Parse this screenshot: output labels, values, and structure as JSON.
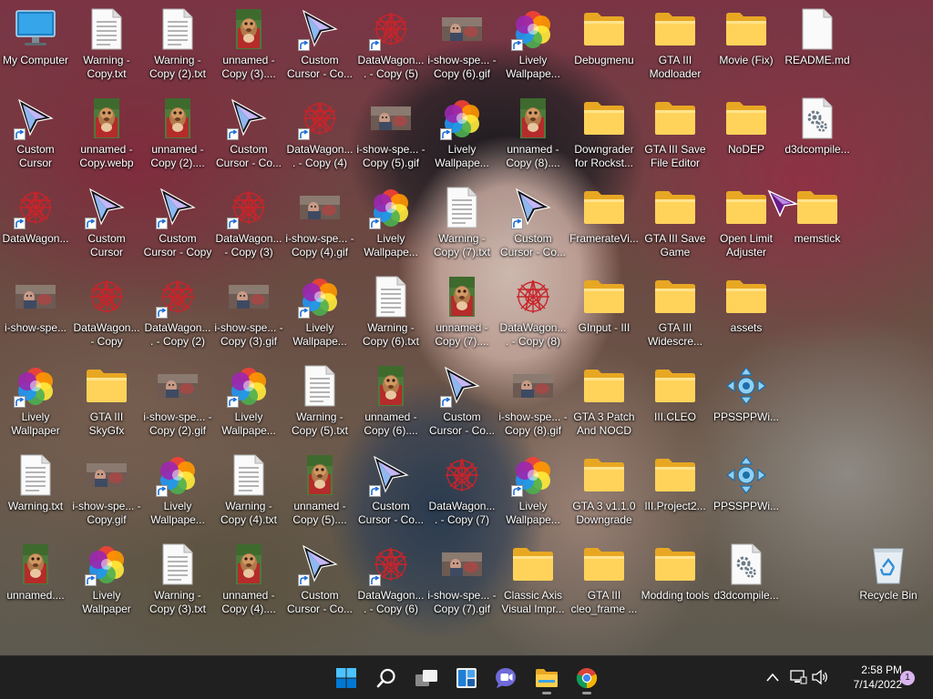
{
  "desktop": {
    "icons": [
      {
        "name": "my-computer",
        "label": "My Computer",
        "type": "computer",
        "shortcut": false
      },
      {
        "name": "warning-copy-txt",
        "label": "Warning - Copy.txt",
        "type": "txt",
        "shortcut": false
      },
      {
        "name": "warning-copy-2-txt",
        "label": "Warning - Copy (2).txt",
        "type": "txt",
        "shortcut": false
      },
      {
        "name": "unnamed-copy-3",
        "label": "unnamed - Copy (3)....",
        "type": "webp",
        "shortcut": false
      },
      {
        "name": "custom-cursor-copy-a",
        "label": "Custom Cursor - Co...",
        "type": "cursor",
        "shortcut": true
      },
      {
        "name": "datawagon-copy-5",
        "label": "DataWagon.... - Copy (5)",
        "type": "wagon",
        "shortcut": true
      },
      {
        "name": "i-show-spe-copy-6-gif",
        "label": "i-show-spe... - Copy (6).gif",
        "type": "gif",
        "shortcut": false
      },
      {
        "name": "lively-wallpaper-a",
        "label": "Lively Wallpape...",
        "type": "lively",
        "shortcut": true
      },
      {
        "name": "debugmenu-folder",
        "label": "Debugmenu",
        "type": "folder",
        "shortcut": false
      },
      {
        "name": "gta3-modloader-folder",
        "label": "GTA III Modloader",
        "type": "folder",
        "shortcut": false
      },
      {
        "name": "movie-fix-folder",
        "label": "Movie (Fix)",
        "type": "folder",
        "shortcut": false
      },
      {
        "name": "readme-md",
        "label": "README.md",
        "type": "blank",
        "shortcut": false
      },
      {
        "name": "custom-cursor-a",
        "label": "Custom Cursor",
        "type": "cursor",
        "shortcut": true
      },
      {
        "name": "unnamed-copy-webp",
        "label": "unnamed - Copy.webp",
        "type": "webp",
        "shortcut": false
      },
      {
        "name": "unnamed-copy-2",
        "label": "unnamed - Copy (2)....",
        "type": "webp",
        "shortcut": false
      },
      {
        "name": "custom-cursor-copy-b",
        "label": "Custom Cursor - Co...",
        "type": "cursor",
        "shortcut": true
      },
      {
        "name": "datawagon-copy-4",
        "label": "DataWagon.... - Copy (4)",
        "type": "wagon",
        "shortcut": true
      },
      {
        "name": "i-show-spe-copy-5-gif",
        "label": "i-show-spe... - Copy (5).gif",
        "type": "gif",
        "shortcut": false
      },
      {
        "name": "lively-wallpaper-b",
        "label": "Lively Wallpape...",
        "type": "lively",
        "shortcut": true
      },
      {
        "name": "unnamed-copy-8",
        "label": "unnamed - Copy (8)....",
        "type": "webp",
        "shortcut": false
      },
      {
        "name": "downgrader-folder",
        "label": "Downgrader for Rockst...",
        "type": "folder",
        "shortcut": false
      },
      {
        "name": "gta3-save-file-editor-folder",
        "label": "GTA III Save File Editor",
        "type": "folder",
        "shortcut": false
      },
      {
        "name": "nodep-folder",
        "label": "NoDEP",
        "type": "folder",
        "shortcut": false
      },
      {
        "name": "d3dcompile-a",
        "label": "d3dcompile...",
        "type": "dll",
        "shortcut": false
      },
      {
        "name": "datawagon-a",
        "label": "DataWagon...",
        "type": "wagon",
        "shortcut": true
      },
      {
        "name": "custom-cursor-b",
        "label": "Custom Cursor",
        "type": "cursor",
        "shortcut": true
      },
      {
        "name": "custom-cursor-copy-c",
        "label": "Custom Cursor - Copy",
        "type": "cursor",
        "shortcut": true
      },
      {
        "name": "datawagon-copy-3",
        "label": "DataWagon... - Copy (3)",
        "type": "wagon",
        "shortcut": true
      },
      {
        "name": "i-show-spe-copy-4-gif",
        "label": "i-show-spe... - Copy (4).gif",
        "type": "gif",
        "shortcut": false
      },
      {
        "name": "lively-wallpaper-c",
        "label": "Lively Wallpape...",
        "type": "lively",
        "shortcut": true
      },
      {
        "name": "warning-copy-7-txt",
        "label": "Warning - Copy (7).txt",
        "type": "txt",
        "shortcut": false
      },
      {
        "name": "custom-cursor-copy-d",
        "label": "Custom Cursor - Co...",
        "type": "cursor",
        "shortcut": true
      },
      {
        "name": "framerate-folder",
        "label": "FramerateVi...",
        "type": "folder",
        "shortcut": false
      },
      {
        "name": "gta3-save-game-folder",
        "label": "GTA III Save Game",
        "type": "folder",
        "shortcut": false
      },
      {
        "name": "open-limit-adjuster-folder",
        "label": "Open Limit Adjuster",
        "type": "folder",
        "shortcut": false
      },
      {
        "name": "memstick-folder",
        "label": "memstick",
        "type": "folder",
        "shortcut": false
      },
      {
        "name": "i-show-spe-a",
        "label": "i-show-spe...",
        "type": "gif",
        "shortcut": false
      },
      {
        "name": "datawagon-copy-a",
        "label": "DataWagon... - Copy",
        "type": "wagon",
        "shortcut": false
      },
      {
        "name": "datawagon-copy-2",
        "label": "DataWagon.... - Copy (2)",
        "type": "wagon",
        "shortcut": true
      },
      {
        "name": "i-show-spe-copy-3-gif",
        "label": "i-show-spe... - Copy (3).gif",
        "type": "gif",
        "shortcut": false
      },
      {
        "name": "lively-wallpaper-d",
        "label": "Lively Wallpape...",
        "type": "lively",
        "shortcut": true
      },
      {
        "name": "warning-copy-6-txt",
        "label": "Warning - Copy (6).txt",
        "type": "txt",
        "shortcut": false
      },
      {
        "name": "unnamed-copy-7",
        "label": "unnamed - Copy (7)....",
        "type": "webp",
        "shortcut": false
      },
      {
        "name": "datawagon-copy-8",
        "label": "DataWagon.... - Copy (8)",
        "type": "wagon",
        "shortcut": false
      },
      {
        "name": "ginput-folder",
        "label": "GInput - III",
        "type": "folder",
        "shortcut": false
      },
      {
        "name": "gta3-widescreen-folder",
        "label": "GTA III Widescre...",
        "type": "folder",
        "shortcut": false
      },
      {
        "name": "assets-folder",
        "label": "assets",
        "type": "folder",
        "shortcut": false
      },
      {
        "name": "empty-r4c12",
        "label": "",
        "type": "none",
        "shortcut": false
      },
      {
        "name": "lively-wallpaper-e",
        "label": "Lively Wallpaper",
        "type": "lively",
        "shortcut": true
      },
      {
        "name": "gta3-skygfx-folder",
        "label": "GTA III SkyGfx",
        "type": "folder",
        "shortcut": false
      },
      {
        "name": "i-show-spe-copy-2-gif",
        "label": "i-show-spe... - Copy (2).gif",
        "type": "gif",
        "shortcut": false
      },
      {
        "name": "lively-wallpaper-f",
        "label": "Lively Wallpape...",
        "type": "lively",
        "shortcut": true
      },
      {
        "name": "warning-copy-5-txt",
        "label": "Warning - Copy (5).txt",
        "type": "txt",
        "shortcut": false
      },
      {
        "name": "unnamed-copy-6",
        "label": "unnamed - Copy (6)....",
        "type": "webp",
        "shortcut": false
      },
      {
        "name": "custom-cursor-copy-e",
        "label": "Custom Cursor - Co...",
        "type": "cursor",
        "shortcut": true
      },
      {
        "name": "i-show-spe-copy-8-gif",
        "label": "i-show-spe... - Copy (8).gif",
        "type": "gif",
        "shortcut": false
      },
      {
        "name": "gta3-patch-folder",
        "label": "GTA 3 Patch And NOCD",
        "type": "folder",
        "shortcut": false
      },
      {
        "name": "iii-cleo-folder",
        "label": "III.CLEO",
        "type": "folder",
        "shortcut": false
      },
      {
        "name": "ppsspp-a",
        "label": "PPSSPPWi...",
        "type": "ppsspp",
        "shortcut": false
      },
      {
        "name": "empty-r5c12",
        "label": "",
        "type": "none",
        "shortcut": false
      },
      {
        "name": "warning-txt",
        "label": "Warning.txt",
        "type": "txt",
        "shortcut": false
      },
      {
        "name": "i-show-spe-copy-gif",
        "label": "i-show-spe... - Copy.gif",
        "type": "gif",
        "shortcut": false
      },
      {
        "name": "lively-wallpaper-g",
        "label": "Lively Wallpape...",
        "type": "lively",
        "shortcut": true
      },
      {
        "name": "warning-copy-4-txt",
        "label": "Warning - Copy (4).txt",
        "type": "txt",
        "shortcut": false
      },
      {
        "name": "unnamed-copy-5",
        "label": "unnamed - Copy (5)....",
        "type": "webp",
        "shortcut": false
      },
      {
        "name": "custom-cursor-copy-f",
        "label": "Custom Cursor - Co...",
        "type": "cursor",
        "shortcut": true
      },
      {
        "name": "datawagon-copy-7",
        "label": "DataWagon.... - Copy (7)",
        "type": "wagon",
        "shortcut": false
      },
      {
        "name": "lively-wallpaper-h",
        "label": "Lively Wallpape...",
        "type": "lively",
        "shortcut": true
      },
      {
        "name": "gta3-v110-downgrade-folder",
        "label": "GTA 3 v1.1.0 Downgrade",
        "type": "folder",
        "shortcut": false
      },
      {
        "name": "iii-project2-folder",
        "label": "III.Project2...",
        "type": "folder",
        "shortcut": false
      },
      {
        "name": "ppsspp-b",
        "label": "PPSSPPWi...",
        "type": "ppsspp",
        "shortcut": false
      },
      {
        "name": "empty-r6c12",
        "label": "",
        "type": "none",
        "shortcut": false
      },
      {
        "name": "unnamed-a",
        "label": "unnamed....",
        "type": "webp",
        "shortcut": false
      },
      {
        "name": "lively-wallpaper-i",
        "label": "Lively Wallpaper",
        "type": "lively",
        "shortcut": true
      },
      {
        "name": "warning-copy-3-txt",
        "label": "Warning - Copy (3).txt",
        "type": "txt",
        "shortcut": false
      },
      {
        "name": "unnamed-copy-4",
        "label": "unnamed - Copy (4)....",
        "type": "webp",
        "shortcut": false
      },
      {
        "name": "custom-cursor-copy-g",
        "label": "Custom Cursor - Co...",
        "type": "cursor",
        "shortcut": true
      },
      {
        "name": "datawagon-copy-6",
        "label": "DataWagon.... - Copy (6)",
        "type": "wagon",
        "shortcut": true
      },
      {
        "name": "i-show-spe-copy-7-gif",
        "label": "i-show-spe... - Copy (7).gif",
        "type": "gif",
        "shortcut": false
      },
      {
        "name": "classic-axis-folder",
        "label": "Classic Axis Visual Impr...",
        "type": "folder",
        "shortcut": false
      },
      {
        "name": "gta3-cleo-frame-folder",
        "label": "GTA III cleo_frame ...",
        "type": "folder",
        "shortcut": false
      },
      {
        "name": "modding-tools-folder",
        "label": "Modding tools",
        "type": "folder",
        "shortcut": false
      },
      {
        "name": "d3dcompile-b",
        "label": "d3dcompile...",
        "type": "dll",
        "shortcut": false
      },
      {
        "name": "empty-r7c12",
        "label": "",
        "type": "none",
        "shortcut": false
      }
    ],
    "recycle_bin": {
      "label": "Recycle Bin"
    }
  },
  "taskbar": {
    "apps": [
      {
        "name": "start-button",
        "icon": "windows-logo-icon"
      },
      {
        "name": "search-button",
        "icon": "search-icon"
      },
      {
        "name": "task-view-button",
        "icon": "task-view-icon"
      },
      {
        "name": "widgets-button",
        "icon": "widgets-icon"
      },
      {
        "name": "teams-chat-button",
        "icon": "chat-icon"
      },
      {
        "name": "file-explorer-button",
        "icon": "folder-icon"
      },
      {
        "name": "chrome-button",
        "icon": "chrome-icon"
      }
    ],
    "clock": {
      "time": "2:58 PM",
      "date": "7/14/2022"
    },
    "notification_count": "1",
    "colors": {
      "bg": "#202020",
      "accent": "#0078d4"
    }
  }
}
